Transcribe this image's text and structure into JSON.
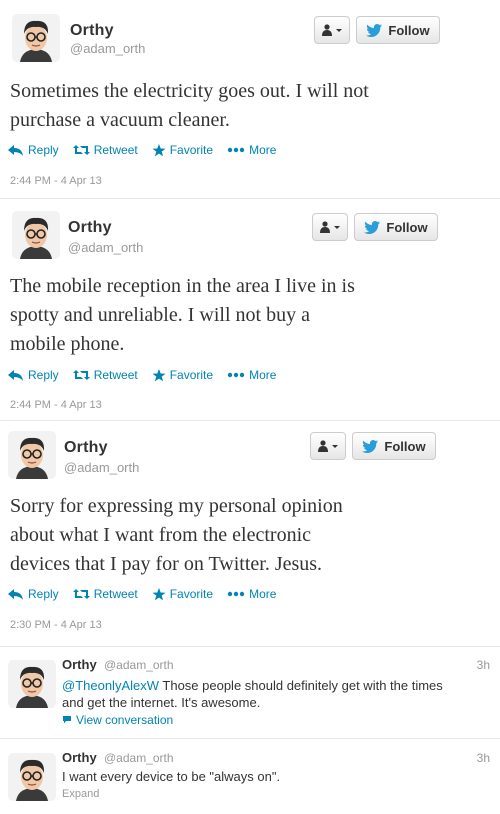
{
  "colors": {
    "link": "#0084b4",
    "muted": "#999999",
    "text": "#333333"
  },
  "tweets": [
    {
      "name": "Orthy",
      "handle": "@adam_orth",
      "follow_label": "Follow",
      "text_lines": [
        "Sometimes the electricity goes out. I will not",
        "purchase a vacuum cleaner."
      ],
      "actions": {
        "reply": "Reply",
        "retweet": "Retweet",
        "favorite": "Favorite",
        "more": "More"
      },
      "timestamp": "2:44 PM - 4 Apr 13"
    },
    {
      "name": "Orthy",
      "handle": "@adam_orth",
      "follow_label": "Follow",
      "text_lines": [
        "The mobile reception in the area I live in is",
        "spotty and unreliable. I will not buy a",
        "mobile phone."
      ],
      "actions": {
        "reply": "Reply",
        "retweet": "Retweet",
        "favorite": "Favorite",
        "more": "More"
      },
      "timestamp": "2:44 PM - 4 Apr 13"
    },
    {
      "name": "Orthy",
      "handle": "@adam_orth",
      "follow_label": "Follow",
      "text_lines": [
        "Sorry for expressing my personal opinion",
        "about what I want from the electronic",
        "devices that I pay for on Twitter. Jesus."
      ],
      "actions": {
        "reply": "Reply",
        "retweet": "Retweet",
        "favorite": "Favorite",
        "more": "More"
      },
      "timestamp": "2:30 PM - 4 Apr 13"
    }
  ],
  "replies": [
    {
      "name": "Orthy",
      "handle": "@adam_orth",
      "time": "3h",
      "mention": "@TheonlyAlexW",
      "text_line1": " Those people should definitely get with the times",
      "text_line2": "and get the internet. It's awesome.",
      "link": "View conversation"
    },
    {
      "name": "Orthy",
      "handle": "@adam_orth",
      "time": "3h",
      "text_line1": "I want every device to be \"always on\".",
      "expand": "Expand"
    }
  ]
}
